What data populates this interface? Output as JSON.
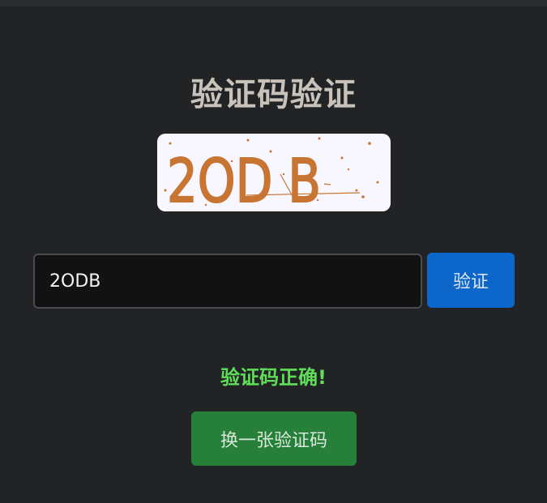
{
  "page": {
    "title": "验证码验证"
  },
  "captcha": {
    "text": "2OD B",
    "text_color": "#c87533",
    "background": "#f8f7ff"
  },
  "form": {
    "input_value": "2ODB",
    "verify_label": "验证"
  },
  "status": {
    "message": "验证码正确!",
    "color": "#5fde59"
  },
  "actions": {
    "refresh_label": "换一张验证码"
  },
  "colors": {
    "background": "#222325",
    "verify_button": "#0d67ca",
    "refresh_button": "#268039"
  }
}
